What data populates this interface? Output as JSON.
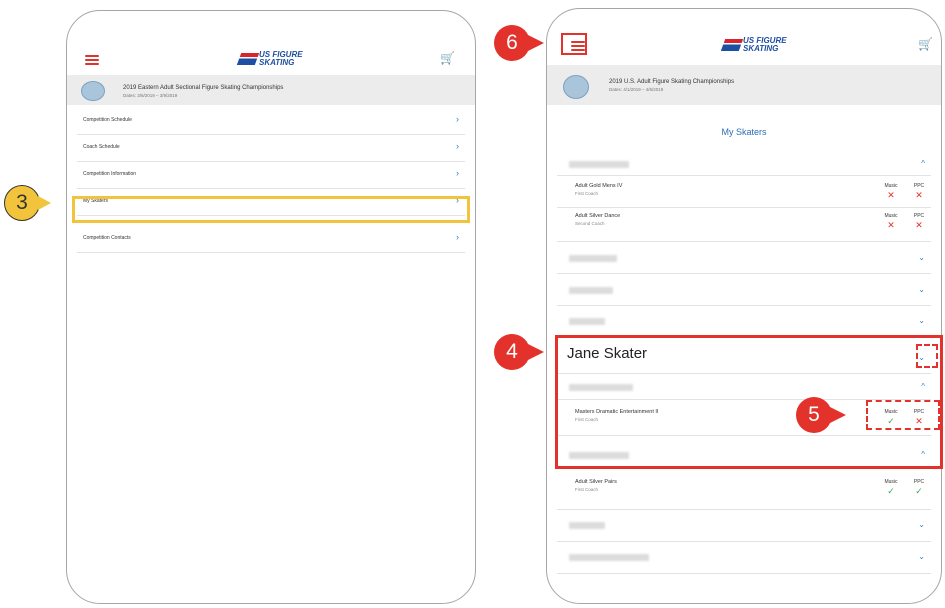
{
  "callouts": {
    "c3": "3",
    "c4": "4",
    "c5": "5",
    "c6": "6"
  },
  "left": {
    "logo_text": "US FIGURE\nSKATING",
    "competition": {
      "title": "2019 Eastern Adult Sectional Figure Skating Championships",
      "dates": "Dates: 3/6/2019 – 3/9/2019"
    },
    "menu": [
      {
        "label": "Competition Schedule"
      },
      {
        "label": "Coach Schedule"
      },
      {
        "label": "Competition Information"
      },
      {
        "label": "My Skaters"
      },
      {
        "label": "Competition Contacts"
      }
    ],
    "chevron": "›"
  },
  "right": {
    "logo_text": "US FIGURE\nSKATING",
    "competition": {
      "title": "2019 U.S. Adult Figure Skating Championships",
      "dates": "Dates: 4/1/2019 – 4/6/2019"
    },
    "screen_title": "My Skaters",
    "status_labels": {
      "music": "Music",
      "ppc": "PPC"
    },
    "chevron_up": "^",
    "chevron_down": "⌄",
    "events": [
      {
        "event": "Adult Gold Mens IV",
        "coach": "First Coach",
        "music": "x",
        "ppc": "x"
      },
      {
        "event": "Adult Silver Dance",
        "coach": "Second Coach",
        "music": "x",
        "ppc": "x"
      },
      {
        "event": "Masters Dramatic Entertainment II",
        "coach": "First Coach",
        "music": "check",
        "ppc": "x"
      },
      {
        "event": "Adult Silver Pairs",
        "coach": "First Coach",
        "music": "check",
        "ppc": "check"
      }
    ],
    "skater_name": "Jane Skater"
  },
  "colors": {
    "accent_red": "#e2322b",
    "highlight_yellow": "#f2c43b",
    "link_blue": "#2d7fd3",
    "check_green": "#3aa85a"
  },
  "icons": {
    "menu": "hamburger-icon",
    "cart": "cart-icon",
    "x": "x-mark-icon",
    "check": "check-mark-icon"
  }
}
